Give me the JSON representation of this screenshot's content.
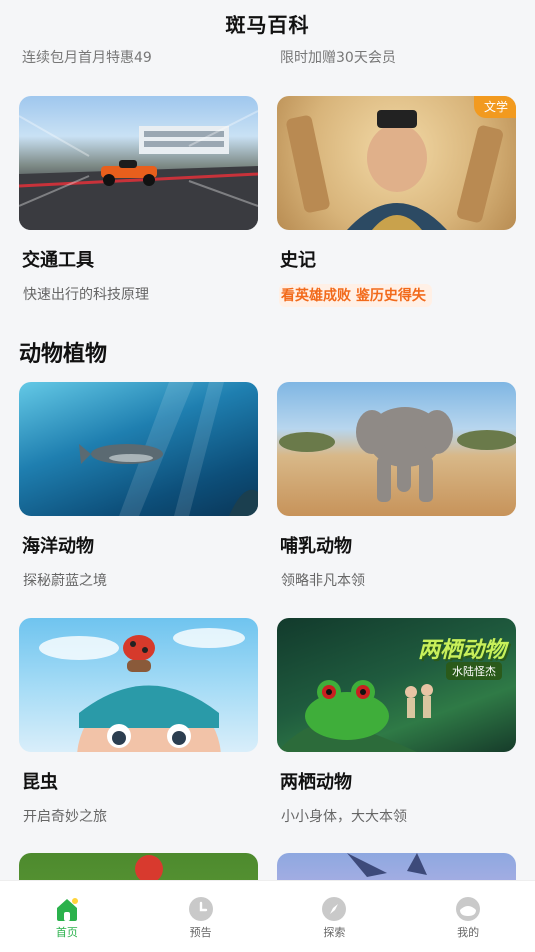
{
  "header": {
    "title": "斑马百科"
  },
  "partial_row": {
    "left_sub": "连续包月首月特惠49",
    "right_sub": "限时加赠30天会员"
  },
  "cards_row1": [
    {
      "title": "交通工具",
      "subtitle": "快速出行的科技原理",
      "image": "race-car-scene"
    },
    {
      "title": "史记",
      "subtitle": "看英雄成败 鉴历史得失",
      "tag": "文学",
      "image": "ancient-hero-scene"
    }
  ],
  "section": {
    "title": "动物植物"
  },
  "cards_row2": [
    {
      "title": "海洋动物",
      "subtitle": "探秘蔚蓝之境",
      "image": "whale-underwater"
    },
    {
      "title": "哺乳动物",
      "subtitle": "领略非凡本领",
      "image": "elephant-savanna"
    }
  ],
  "cards_row3": [
    {
      "title": "昆虫",
      "subtitle": "开启奇妙之旅",
      "image": "ladybug-cartoon-boy"
    },
    {
      "title": "两栖动物",
      "subtitle": "小小身体，大大本领",
      "image": "frog-jungle",
      "overlay_title": "两栖动物",
      "overlay_sub": "水陆怪杰"
    }
  ],
  "tabbar": [
    {
      "label": "首页",
      "icon": "home-icon",
      "active": true
    },
    {
      "label": "预告",
      "icon": "clock-icon",
      "active": false
    },
    {
      "label": "探索",
      "icon": "compass-icon",
      "active": false
    },
    {
      "label": "我的",
      "icon": "profile-icon",
      "active": false
    }
  ],
  "colors": {
    "accent": "#2bb24c",
    "highlight": "#f26a1b",
    "tag": "#f29a1f"
  }
}
